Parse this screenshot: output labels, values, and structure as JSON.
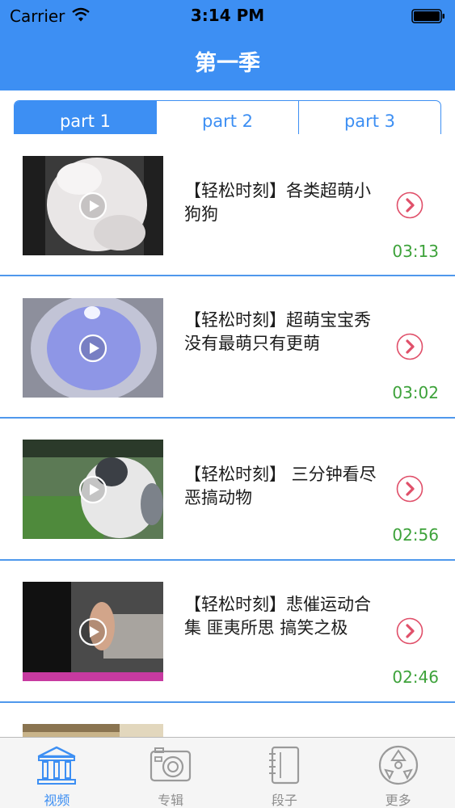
{
  "status_bar": {
    "carrier": "Carrier",
    "time": "3:14 PM"
  },
  "nav": {
    "title": "第一季"
  },
  "segments": {
    "items": [
      "part 1",
      "part 2",
      "part 3"
    ],
    "selected": "part 1"
  },
  "videos": [
    {
      "title": "【轻松时刻】各类超萌小狗狗",
      "duration": "03:13",
      "thumbnail": "white-puppy"
    },
    {
      "title": "【轻松时刻】超萌宝宝秀　没有最萌只有更萌",
      "duration": "03:02",
      "thumbnail": "blue-bowl"
    },
    {
      "title": "【轻松时刻】 三分钟看尽恶搞动物",
      "duration": "02:56",
      "thumbnail": "dog-on-grass"
    },
    {
      "title": "【轻松时刻】悲催运动合集  匪夷所思  搞笑之极",
      "duration": "02:46",
      "thumbnail": "dark-room"
    }
  ],
  "tab_bar": {
    "items": [
      {
        "label": "视频",
        "icon": "museum-icon"
      },
      {
        "label": "专辑",
        "icon": "camera-icon"
      },
      {
        "label": "段子",
        "icon": "notebook-icon"
      },
      {
        "label": "更多",
        "icon": "film-reel-icon"
      }
    ],
    "selected": "视频"
  },
  "colors": {
    "accent": "#3d8ff3",
    "duration_green": "#3da23a",
    "arrow_red": "#e0506a",
    "tab_inactive": "#8e8e8e"
  }
}
